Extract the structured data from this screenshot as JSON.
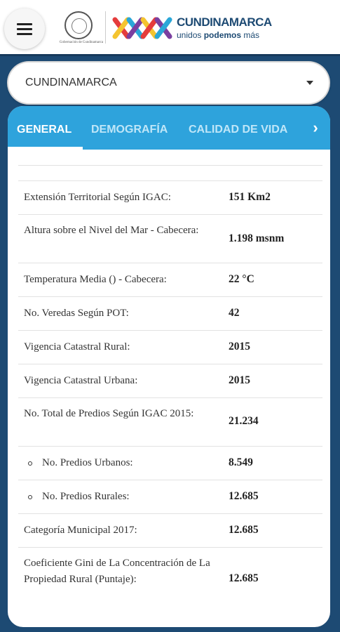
{
  "header": {
    "seal_caption": "Gobernación de Cundinamarca",
    "brand_name": "CUNDINAMARCA",
    "brand_tag_pre": "unidos ",
    "brand_tag_bold": "podemos",
    "brand_tag_post": " más",
    "icons": [
      "menu-icon",
      "coat-of-arms-icon",
      "logo-x-icon"
    ],
    "colors": {
      "navy": "#1d4a73",
      "x1": "#e53c3c",
      "x2": "#f4c430",
      "x3": "#2aa7d8",
      "x4": "#7a3fa0"
    }
  },
  "selector": {
    "value": "CUNDINAMARCA"
  },
  "tabs": {
    "items": [
      {
        "label": "GENERAL",
        "active": true
      },
      {
        "label": "DEMOGRAFÍA",
        "active": false
      },
      {
        "label": "CALIDAD DE VIDA",
        "active": false
      }
    ],
    "next_icon": "chevron-right-icon",
    "accent": "#2ea3dc"
  },
  "rows": [
    {
      "label": "Extensión Territorial Según IGAC:",
      "value": "151 Km2",
      "sub": false
    },
    {
      "label": "Altura sobre el Nivel del Mar - Cabecera:",
      "value": "1.198 msnm",
      "sub": false
    },
    {
      "label": "Temperatura Media () - Cabecera:",
      "value": "22 °C",
      "sub": false
    },
    {
      "label": "No. Veredas Según POT:",
      "value": "42",
      "sub": false
    },
    {
      "label": "Vigencia Catastral Rural:",
      "value": "2015",
      "sub": false
    },
    {
      "label": "Vigencia Catastral Urbana:",
      "value": "2015",
      "sub": false
    },
    {
      "label": "No. Total de Predios Según IGAC 2015:",
      "value": "21.234",
      "sub": false
    },
    {
      "label": "No. Predios Urbanos:",
      "value": "8.549",
      "sub": true
    },
    {
      "label": "No. Predios Rurales:",
      "value": "12.685",
      "sub": true
    },
    {
      "label": "Categoría Municipal 2017:",
      "value": "12.685",
      "sub": false
    },
    {
      "label": "Coeficiente Gini de La Concentración de La Propiedad Rural (Puntaje):",
      "value": "12.685",
      "sub": false
    }
  ]
}
